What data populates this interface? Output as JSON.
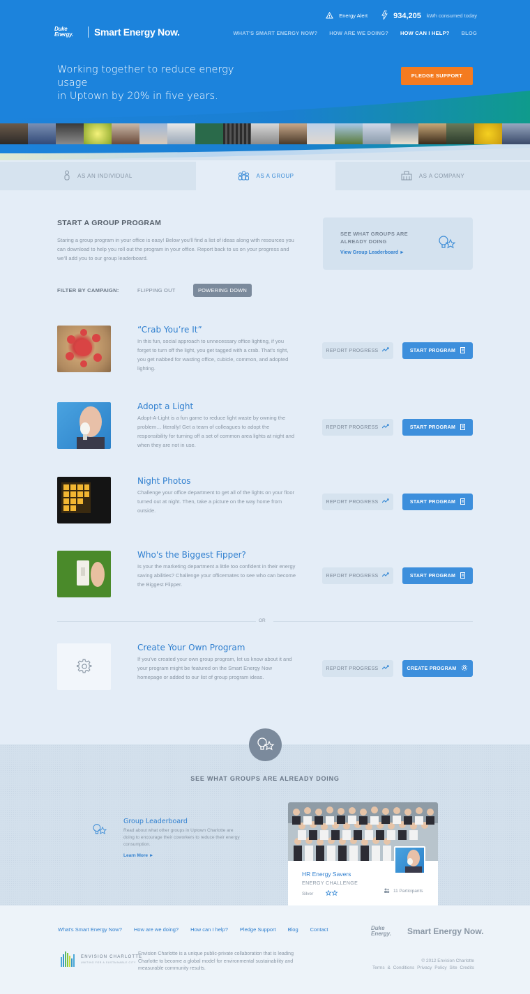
{
  "header": {
    "energy_alert": "Energy Alert",
    "kwh_value": "934,205",
    "kwh_label": "kWh consumed today",
    "logo_brand": "Duke Energy.",
    "logo_title": "Smart Energy Now.",
    "nav": [
      "WHAT'S SMART ENERGY NOW?",
      "HOW ARE WE DOING?",
      "HOW CAN I HELP?",
      "BLOG"
    ],
    "nav_active_index": 2,
    "tagline_line1": "Working together to reduce energy usage",
    "tagline_line2": "in Uptown by 20% in five years.",
    "pledge_label": "PLEDGE SUPPORT"
  },
  "tabs": [
    "AS AN INDIVIDUAL",
    "AS A GROUP",
    "AS A COMPANY"
  ],
  "active_tab": 1,
  "content": {
    "title": "START A GROUP PROGRAM",
    "intro": "Staring a group program in your office is easy! Below you'll find a list of ideas along with resources you can download to help you roll out the program in your office. Report back to us on your progress and we'll add you to our group leaderboard.",
    "see_box_title": "SEE WHAT GROUPS ARE ALREADY DOING",
    "see_box_link": "View Group Leaderboard ►",
    "filter_label": "FILTER BY CAMPAIGN:",
    "filter_options": [
      "FLIPPING OUT",
      "POWERING DOWN"
    ],
    "filter_selected": "POWERING DOWN"
  },
  "programs": [
    {
      "title": "“Crab You’re It”",
      "description": "In this fun, social approach to unnecessary office lighting, if you forget to turn off the light, you get tagged with a crab. That's right, you get nabbed for wasting office, cubicle, common, and adopted lighting.",
      "report": "REPORT PROGRESS",
      "action": "START PROGRAM"
    },
    {
      "title": "Adopt a Light",
      "description": "Adopt-A-Light is a fun game to reduce light waste by owning the problem… literally! Get a team of colleagues to adopt the responsibility for turning off a set of common area lights at night and when they are not in use.",
      "report": "REPORT PROGRESS",
      "action": "START PROGRAM"
    },
    {
      "title": "Night Photos",
      "description": "Challenge your office department to get all of the lights on your floor turned out at night. Then, take a picture on the way home from outside.",
      "report": "REPORT PROGRESS",
      "action": "START PROGRAM"
    },
    {
      "title": "Who's the Biggest Fipper?",
      "description": "Is your the marketing department a little too confident in their energy saving abilities? Challenge your officemates to see who can become the Biggest Flipper.",
      "report": "REPORT PROGRESS",
      "action": "START PROGRAM"
    }
  ],
  "or_label": "OR",
  "custom_program": {
    "title": "Create Your Own Program",
    "description": "If you've created your own group program, let us know about it and your program might be featured on the Smart Energy Now homepage or added to our list of group program ideas.",
    "report": "REPORT PROGRESS",
    "action": "CREATE PROGRAM"
  },
  "groups": {
    "title": "SEE WHAT GROUPS ARE ALREADY DOING",
    "leaderboard_title": "Group Leaderboard",
    "leaderboard_desc": "Read about what other groups in Uptown Charlotte are doing to encourage their coworkers to reduce their energy consumption.",
    "leaderboard_more": "Learn More ►",
    "card": {
      "name": "HR Energy Savers",
      "challenge": "ENERGY CHALLENGE",
      "level": "Silver",
      "participants": "11 Participants"
    }
  },
  "footer": {
    "links": [
      "What's Smart Energy Now?",
      "How are we doing?",
      "How can I help?",
      "Pledge Support",
      "Blog",
      "Contact"
    ],
    "brand": "Duke Energy.",
    "brand_title": "Smart Energy Now.",
    "ec_name": "ENVISION CHARLOTTE",
    "ec_tagline": "UNITING FOR A SUSTAINABLE CITY",
    "description": "Envision Charlotte is a unique public-private collaboration that is leading Charlotte to become a global model for environmental sustainability and measurable community results.",
    "copyright": "© 2012 Envision Charlotte",
    "legal": [
      "Terms & Conditions",
      "Privacy Policy",
      "Site Credits"
    ]
  },
  "colors": {
    "brand_blue": "#1c83dc",
    "accent_orange": "#f47b20",
    "button_blue": "#3d8fdc",
    "link_blue": "#2f7fcf",
    "page_bg": "#e4edf7"
  }
}
